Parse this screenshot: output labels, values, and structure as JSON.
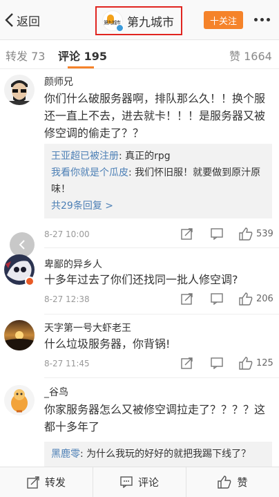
{
  "nav": {
    "back_label": "返回",
    "title": "第九城市",
    "logo_text": "第九城市",
    "follow_label": "十关注"
  },
  "tabs": [
    {
      "label": "转发 73"
    },
    {
      "label": "评论 195"
    },
    {
      "label": "赞 1664"
    }
  ],
  "comments": [
    {
      "user": "颜师兄",
      "text": "你们什么破服务器啊，排队那么久！！换个服还一直上不去，进去就卡！！！是服务器又被修空调的偷走了？？",
      "replies": [
        {
          "user": "王亚超已被注册",
          "text": ": 真正的rpg"
        },
        {
          "user": "我看你就是个瓜皮",
          "text": ": 我们怀旧服！就要做到原汁原味！"
        }
      ],
      "replies_more": "共29条回复 >",
      "time": "8-27 10:00",
      "likes": "539"
    },
    {
      "user": "卑鄙的异乡人",
      "text": "十多年过去了你们还找同一批人修空调?",
      "time": "8-27 12:38",
      "likes": "206"
    },
    {
      "user": "天字第一号大虾老王",
      "text": "什么垃圾服务器，你背锅!",
      "time": "8-27 11:45",
      "likes": "125"
    },
    {
      "user": "_谷鸟",
      "text": "你家服务器怎么又被修空调拉走了？？？？这都十多年了",
      "replies": [
        {
          "user": "黑鹿零",
          "text": ": 为什么我玩的好好的就把我踢下线了？"
        }
      ]
    }
  ],
  "bottom": {
    "repost_label": "转发",
    "comment_label": "评论",
    "like_label": "赞"
  },
  "colors": {
    "accent": "#f5832a",
    "link": "#4c7fb5",
    "highlight_box": "#e0241f"
  }
}
